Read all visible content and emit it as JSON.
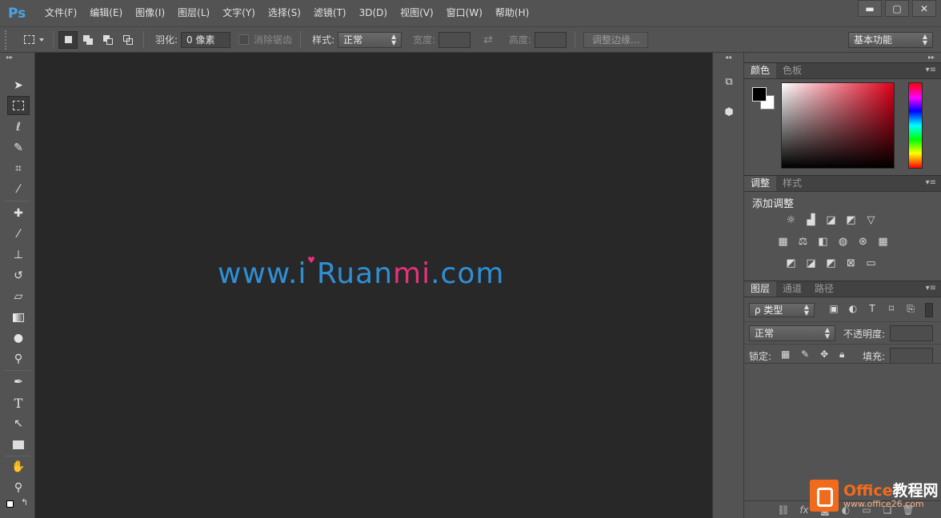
{
  "app": {
    "logo": "Ps"
  },
  "menu": [
    "文件(F)",
    "编辑(E)",
    "图像(I)",
    "图层(L)",
    "文字(Y)",
    "选择(S)",
    "滤镜(T)",
    "3D(D)",
    "视图(V)",
    "窗口(W)",
    "帮助(H)"
  ],
  "window_controls": {
    "minimize": "▬",
    "maximize": "▢",
    "close": "✕"
  },
  "options": {
    "feather_label": "羽化:",
    "feather_value": "0 像素",
    "antialias_label": "消除锯齿",
    "style_label": "样式:",
    "style_value": "正常",
    "width_label": "宽度:",
    "height_label": "高度:",
    "refine_label": "调整边缘...",
    "workspace_value": "基本功能"
  },
  "canvas": {
    "watermark_part1": "www.i Ruan",
    "watermark_part2": "mi",
    "watermark_part3": ".com",
    "accent_blue": "#2f8fd6",
    "accent_pink": "#e8327a"
  },
  "tools": [
    "move-icon",
    "rect-marquee-icon",
    "lasso-icon",
    "quick-select-icon",
    "crop-icon",
    "eyedropper-icon",
    "healing-brush-icon",
    "brush-icon",
    "clone-stamp-icon",
    "history-brush-icon",
    "eraser-icon",
    "gradient-icon",
    "blur-icon",
    "dodge-icon",
    "pen-icon",
    "type-icon",
    "path-select-icon",
    "rectangle-icon",
    "hand-icon",
    "zoom-icon"
  ],
  "color_panel": {
    "tab_color": "颜色",
    "tab_swatches": "色板",
    "foreground": "#000000",
    "background": "#ffffff"
  },
  "adjust_panel": {
    "tab_adjust": "调整",
    "tab_styles": "样式",
    "heading": "添加调整"
  },
  "layers_panel": {
    "tab_layers": "图层",
    "tab_channels": "通道",
    "tab_paths": "路径",
    "filter_value": "ρ 类型",
    "blend_mode": "正常",
    "opacity_label": "不透明度:",
    "lock_label": "锁定:",
    "fill_label": "填充:"
  },
  "site_watermark": {
    "title_office": "Office",
    "title_rest": "教程网",
    "url": "www.office26.com"
  }
}
